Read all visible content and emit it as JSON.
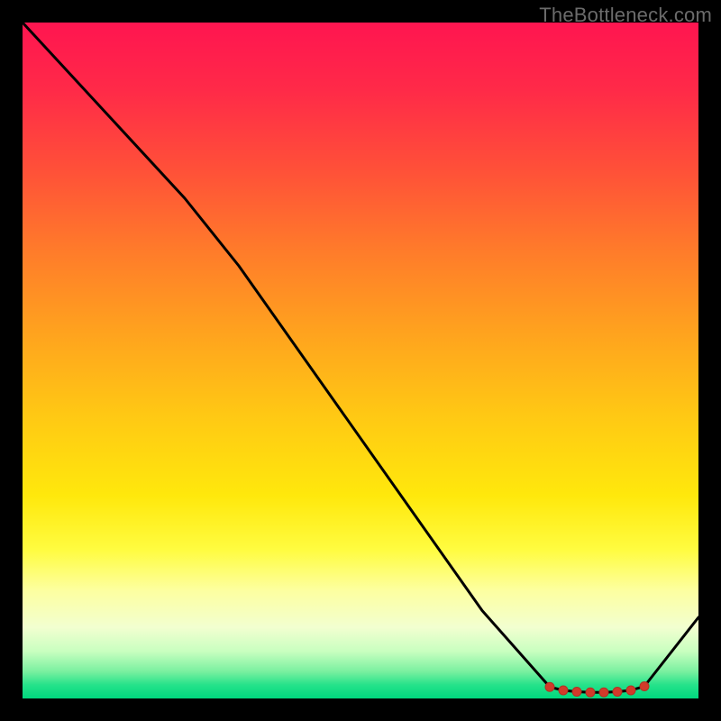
{
  "watermark": "TheBottleneck.com",
  "colors": {
    "line": "#000000",
    "marker_fill": "#d23a2a",
    "marker_stroke": "#b33224",
    "background_frame": "#000000"
  },
  "chart_data": {
    "type": "line",
    "title": "",
    "xlabel": "",
    "ylabel": "",
    "xlim": [
      0,
      100
    ],
    "ylim": [
      0,
      100
    ],
    "grid": false,
    "legend": false,
    "series": [
      {
        "name": "curve",
        "x": [
          0,
          12,
          24,
          32,
          44,
          56,
          68,
          78,
          80,
          82,
          84,
          86,
          88,
          90,
          92,
          100
        ],
        "values": [
          100,
          87,
          74,
          64,
          47,
          30,
          13,
          1.7,
          1.2,
          1.0,
          0.9,
          0.9,
          1.0,
          1.2,
          1.8,
          12
        ],
        "marker_indices": [
          7,
          8,
          9,
          10,
          11,
          12,
          13,
          14
        ]
      }
    ],
    "annotations": []
  }
}
